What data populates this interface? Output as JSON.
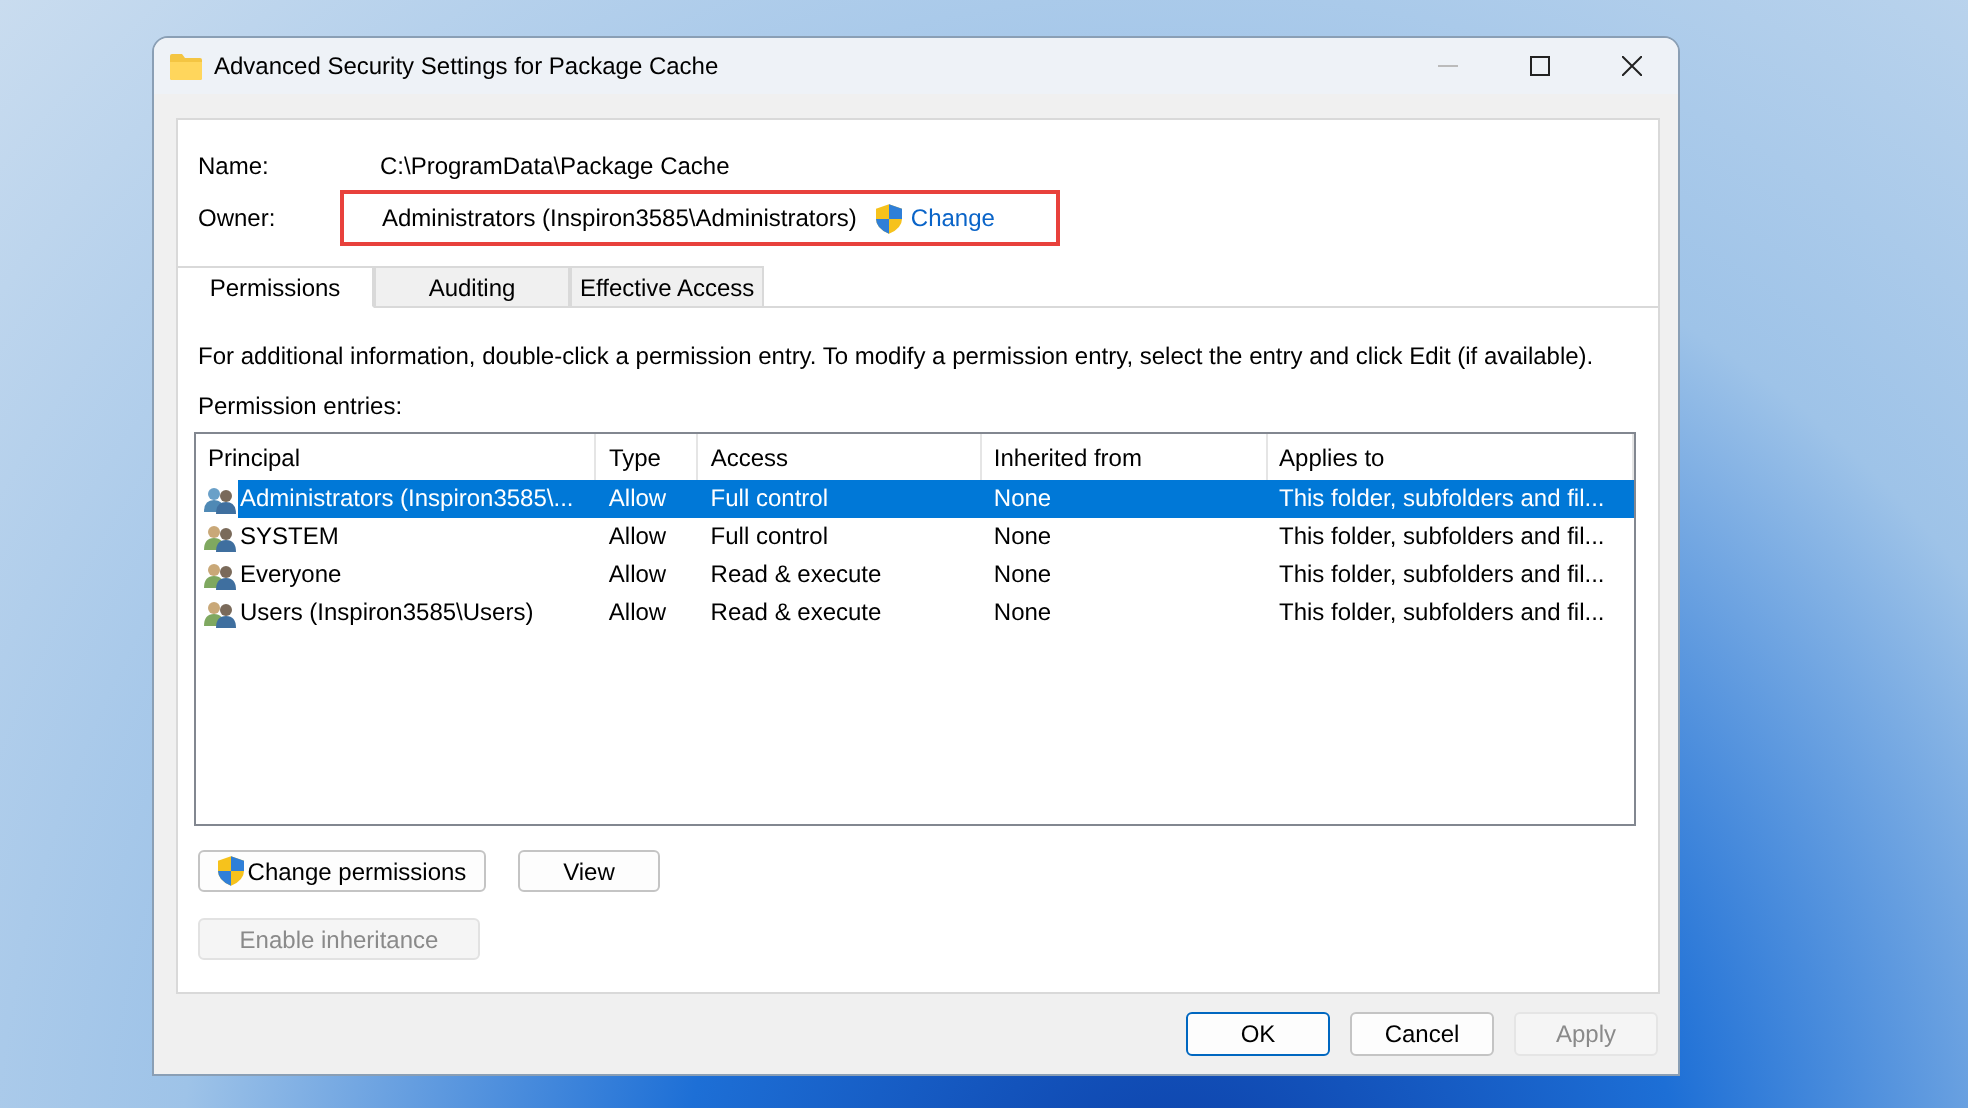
{
  "window": {
    "title": "Advanced Security Settings for Package Cache"
  },
  "name": {
    "label": "Name:",
    "value": "C:\\ProgramData\\Package Cache"
  },
  "owner": {
    "label": "Owner:",
    "value": "Administrators (Inspiron3585\\Administrators)",
    "link": "Change",
    "highlighted": true
  },
  "tabs": [
    {
      "label": "Permissions",
      "selected": true
    },
    {
      "label": "Auditing",
      "selected": false
    },
    {
      "label": "Effective Access",
      "selected": false
    }
  ],
  "info_text": "For additional information, double-click a permission entry. To modify a permission entry, select the entry and click Edit (if available).",
  "entries_label": "Permission entries:",
  "table": {
    "columns": [
      "Principal",
      "Type",
      "Access",
      "Inherited from",
      "Applies to"
    ],
    "rows": [
      {
        "principal": "Administrators (Inspiron3585\\...",
        "type": "Allow",
        "access": "Full control",
        "inherited_from": "None",
        "applies_to": "This folder, subfolders and fil...",
        "selected": true
      },
      {
        "principal": "SYSTEM",
        "type": "Allow",
        "access": "Full control",
        "inherited_from": "None",
        "applies_to": "This folder, subfolders and fil...",
        "selected": false
      },
      {
        "principal": "Everyone",
        "type": "Allow",
        "access": "Read & execute",
        "inherited_from": "None",
        "applies_to": "This folder, subfolders and fil...",
        "selected": false
      },
      {
        "principal": "Users (Inspiron3585\\Users)",
        "type": "Allow",
        "access": "Read & execute",
        "inherited_from": "None",
        "applies_to": "This folder, subfolders and fil...",
        "selected": false
      }
    ]
  },
  "buttons": [
    {
      "label": "Change permissions",
      "shield": true,
      "disabled": false
    },
    {
      "label": "View",
      "shield": false,
      "disabled": false
    }
  ],
  "inheritance_button": {
    "label": "Enable inheritance",
    "disabled": true
  },
  "dialog_buttons": [
    {
      "label": "OK",
      "default": true,
      "disabled": false
    },
    {
      "label": "Cancel",
      "default": false,
      "disabled": false
    },
    {
      "label": "Apply",
      "default": false,
      "disabled": true
    }
  ]
}
